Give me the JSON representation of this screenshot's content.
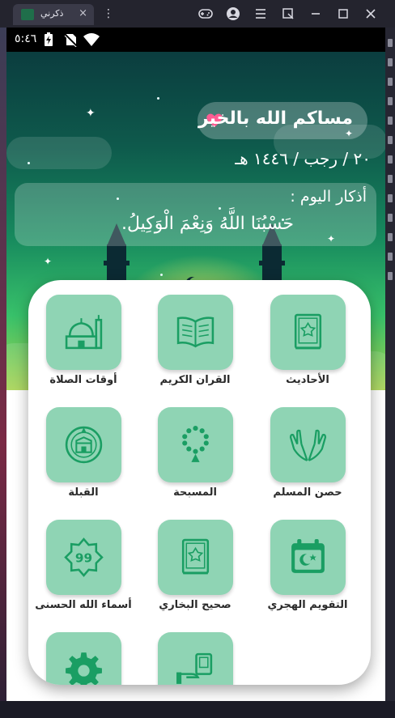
{
  "window": {
    "tab_title": "ذكرني",
    "tab_close": "×",
    "more": "⋮"
  },
  "status_bar": {
    "time": "٥:٤٦"
  },
  "header": {
    "greeting": "مساكم الله بالخير",
    "hijri_date": "٢٠ / رجب / ١٤٤٦ هـ",
    "azkar_title": "أذكار اليوم :",
    "azkar_text": "حَسْبُنَا اللَّهُ وَنِعْمَ الْوَكِيلُ."
  },
  "menu": {
    "items": [
      {
        "label": "الأحاديث",
        "icon": "quran-book-icon"
      },
      {
        "label": "القران الكريم",
        "icon": "open-book-icon"
      },
      {
        "label": "أوقات الصلاة",
        "icon": "mosque-icon"
      },
      {
        "label": "حصن المسلم",
        "icon": "praying-hands-icon"
      },
      {
        "label": "المسبحة",
        "icon": "prayer-beads-icon"
      },
      {
        "label": "القبلة",
        "icon": "kaaba-compass-icon"
      },
      {
        "label": "التقويم الهجري",
        "icon": "calendar-crescent-icon"
      },
      {
        "label": "صحيح البخاري",
        "icon": "book-star-icon"
      },
      {
        "label": "أسماء الله الحسنى",
        "icon": "names-99-icon"
      },
      {
        "label": "",
        "icon": "settings-gear-icon"
      },
      {
        "label": "",
        "icon": "hand-book-icon"
      }
    ]
  },
  "colors": {
    "accent": "#1a9e63",
    "tile_bg": "#8fd4b4",
    "heart": "#ff5c93"
  }
}
